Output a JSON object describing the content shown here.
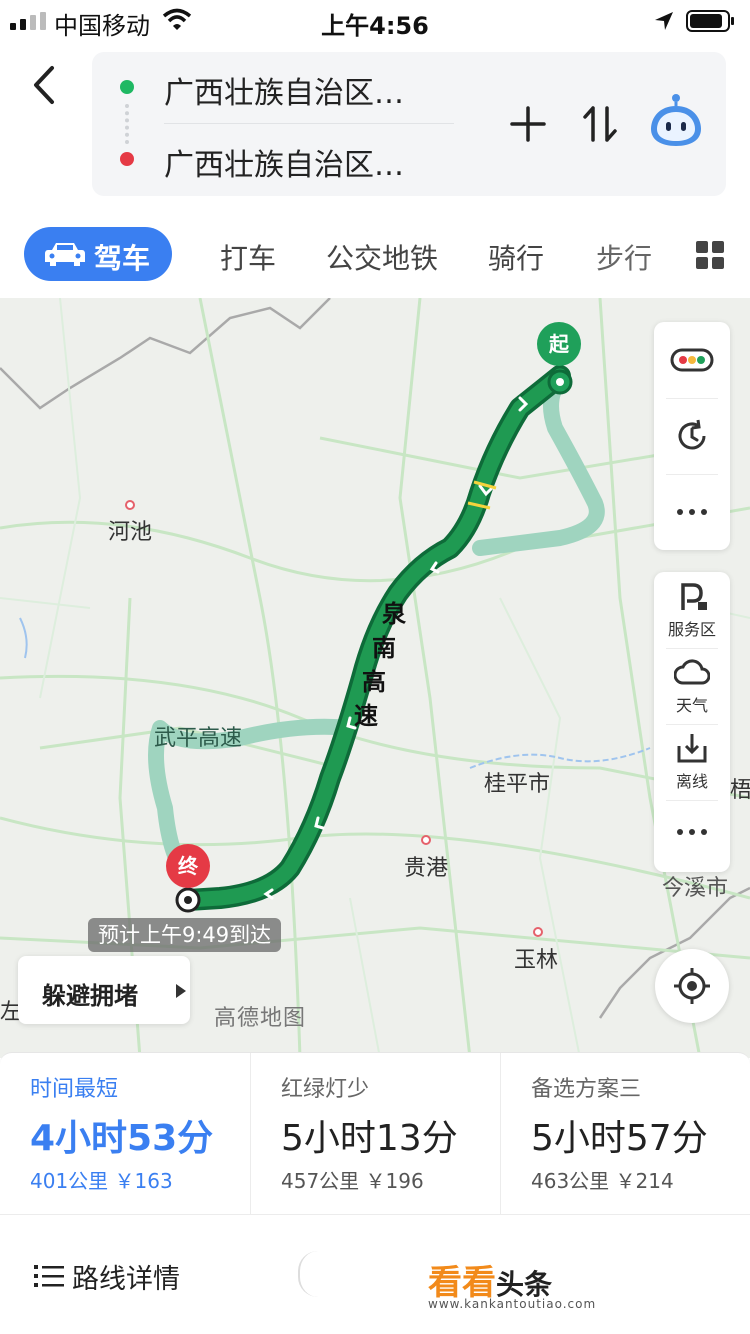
{
  "status_bar": {
    "carrier": "中国移动",
    "time": "上午4:56"
  },
  "route": {
    "origin": "广西壮族自治区…",
    "destination": "广西壮族自治区…"
  },
  "modes": [
    {
      "label": "驾车",
      "active": true
    },
    {
      "label": "打车"
    },
    {
      "label": "公交地铁"
    },
    {
      "label": "骑行"
    },
    {
      "label": "步行"
    }
  ],
  "map": {
    "cities": [
      "河池",
      "桂平市",
      "贵港",
      "玉林",
      "今溪市",
      "梧",
      "左"
    ],
    "main_road_chars": [
      "泉",
      "南",
      "高",
      "速"
    ],
    "alt_road": "武平高速",
    "start_pin": "起",
    "end_pin": "终",
    "eta": "预计上午9:49到达",
    "provider": "高德地图",
    "avoid_label": "躲避拥堵",
    "tools": {
      "service_area": "服务区",
      "weather": "天气",
      "offline": "离线"
    }
  },
  "options": [
    {
      "tag": "时间最短",
      "time": "4小时53分",
      "meta": "401公里 ￥163"
    },
    {
      "tag": "红绿灯少",
      "time": "5小时13分",
      "meta": "457公里 ￥196"
    },
    {
      "tag": "备选方案三",
      "time": "5小时57分",
      "meta": "463公里 ￥214"
    }
  ],
  "bottom": {
    "detail_label": "路线详情",
    "brand_a": "看看",
    "brand_b": "头条",
    "brand_url": "www.kankantoutiao.com"
  },
  "colors": {
    "accent": "#3a7ff1",
    "route_main": "#1f9a52",
    "route_alt": "#9fd4bf",
    "start_pin": "#1fa05a",
    "end_pin": "#e53a45"
  }
}
